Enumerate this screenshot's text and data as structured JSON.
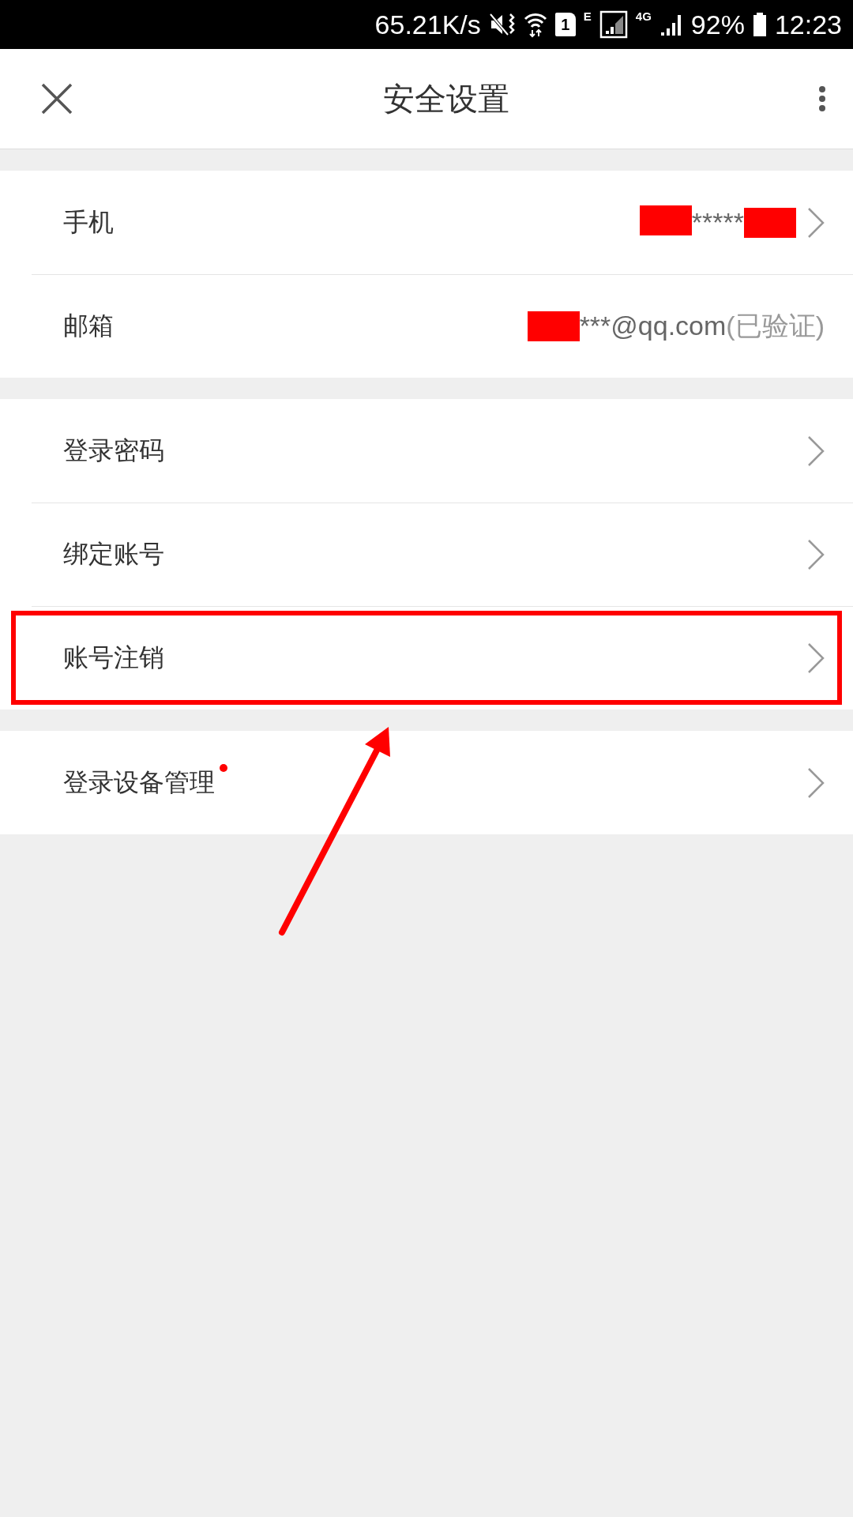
{
  "status_bar": {
    "speed": "65.21K/s",
    "sim": "1",
    "network_e": "E",
    "network_4g": "4G",
    "battery": "92%",
    "time": "12:23"
  },
  "header": {
    "title": "安全设置"
  },
  "groups": [
    {
      "items": [
        {
          "label": "手机",
          "value": [
            {
              "kind": "redaction"
            },
            {
              "kind": "text",
              "text": "*****"
            },
            {
              "kind": "redaction"
            }
          ],
          "chevron": true,
          "dot": false,
          "highlighted": false
        },
        {
          "label": "邮箱",
          "value": [
            {
              "kind": "redaction"
            },
            {
              "kind": "text",
              "text": "***@qq.com"
            },
            {
              "kind": "note",
              "text": "(已验证)"
            }
          ],
          "chevron": false,
          "dot": false,
          "highlighted": false
        }
      ]
    },
    {
      "items": [
        {
          "label": "登录密码",
          "chevron": true,
          "dot": false,
          "highlighted": false
        },
        {
          "label": "绑定账号",
          "chevron": true,
          "dot": false,
          "highlighted": false
        },
        {
          "label": "账号注销",
          "chevron": true,
          "dot": false,
          "highlighted": true
        }
      ]
    },
    {
      "items": [
        {
          "label": "登录设备管理",
          "chevron": true,
          "dot": true,
          "highlighted": false
        }
      ]
    }
  ]
}
